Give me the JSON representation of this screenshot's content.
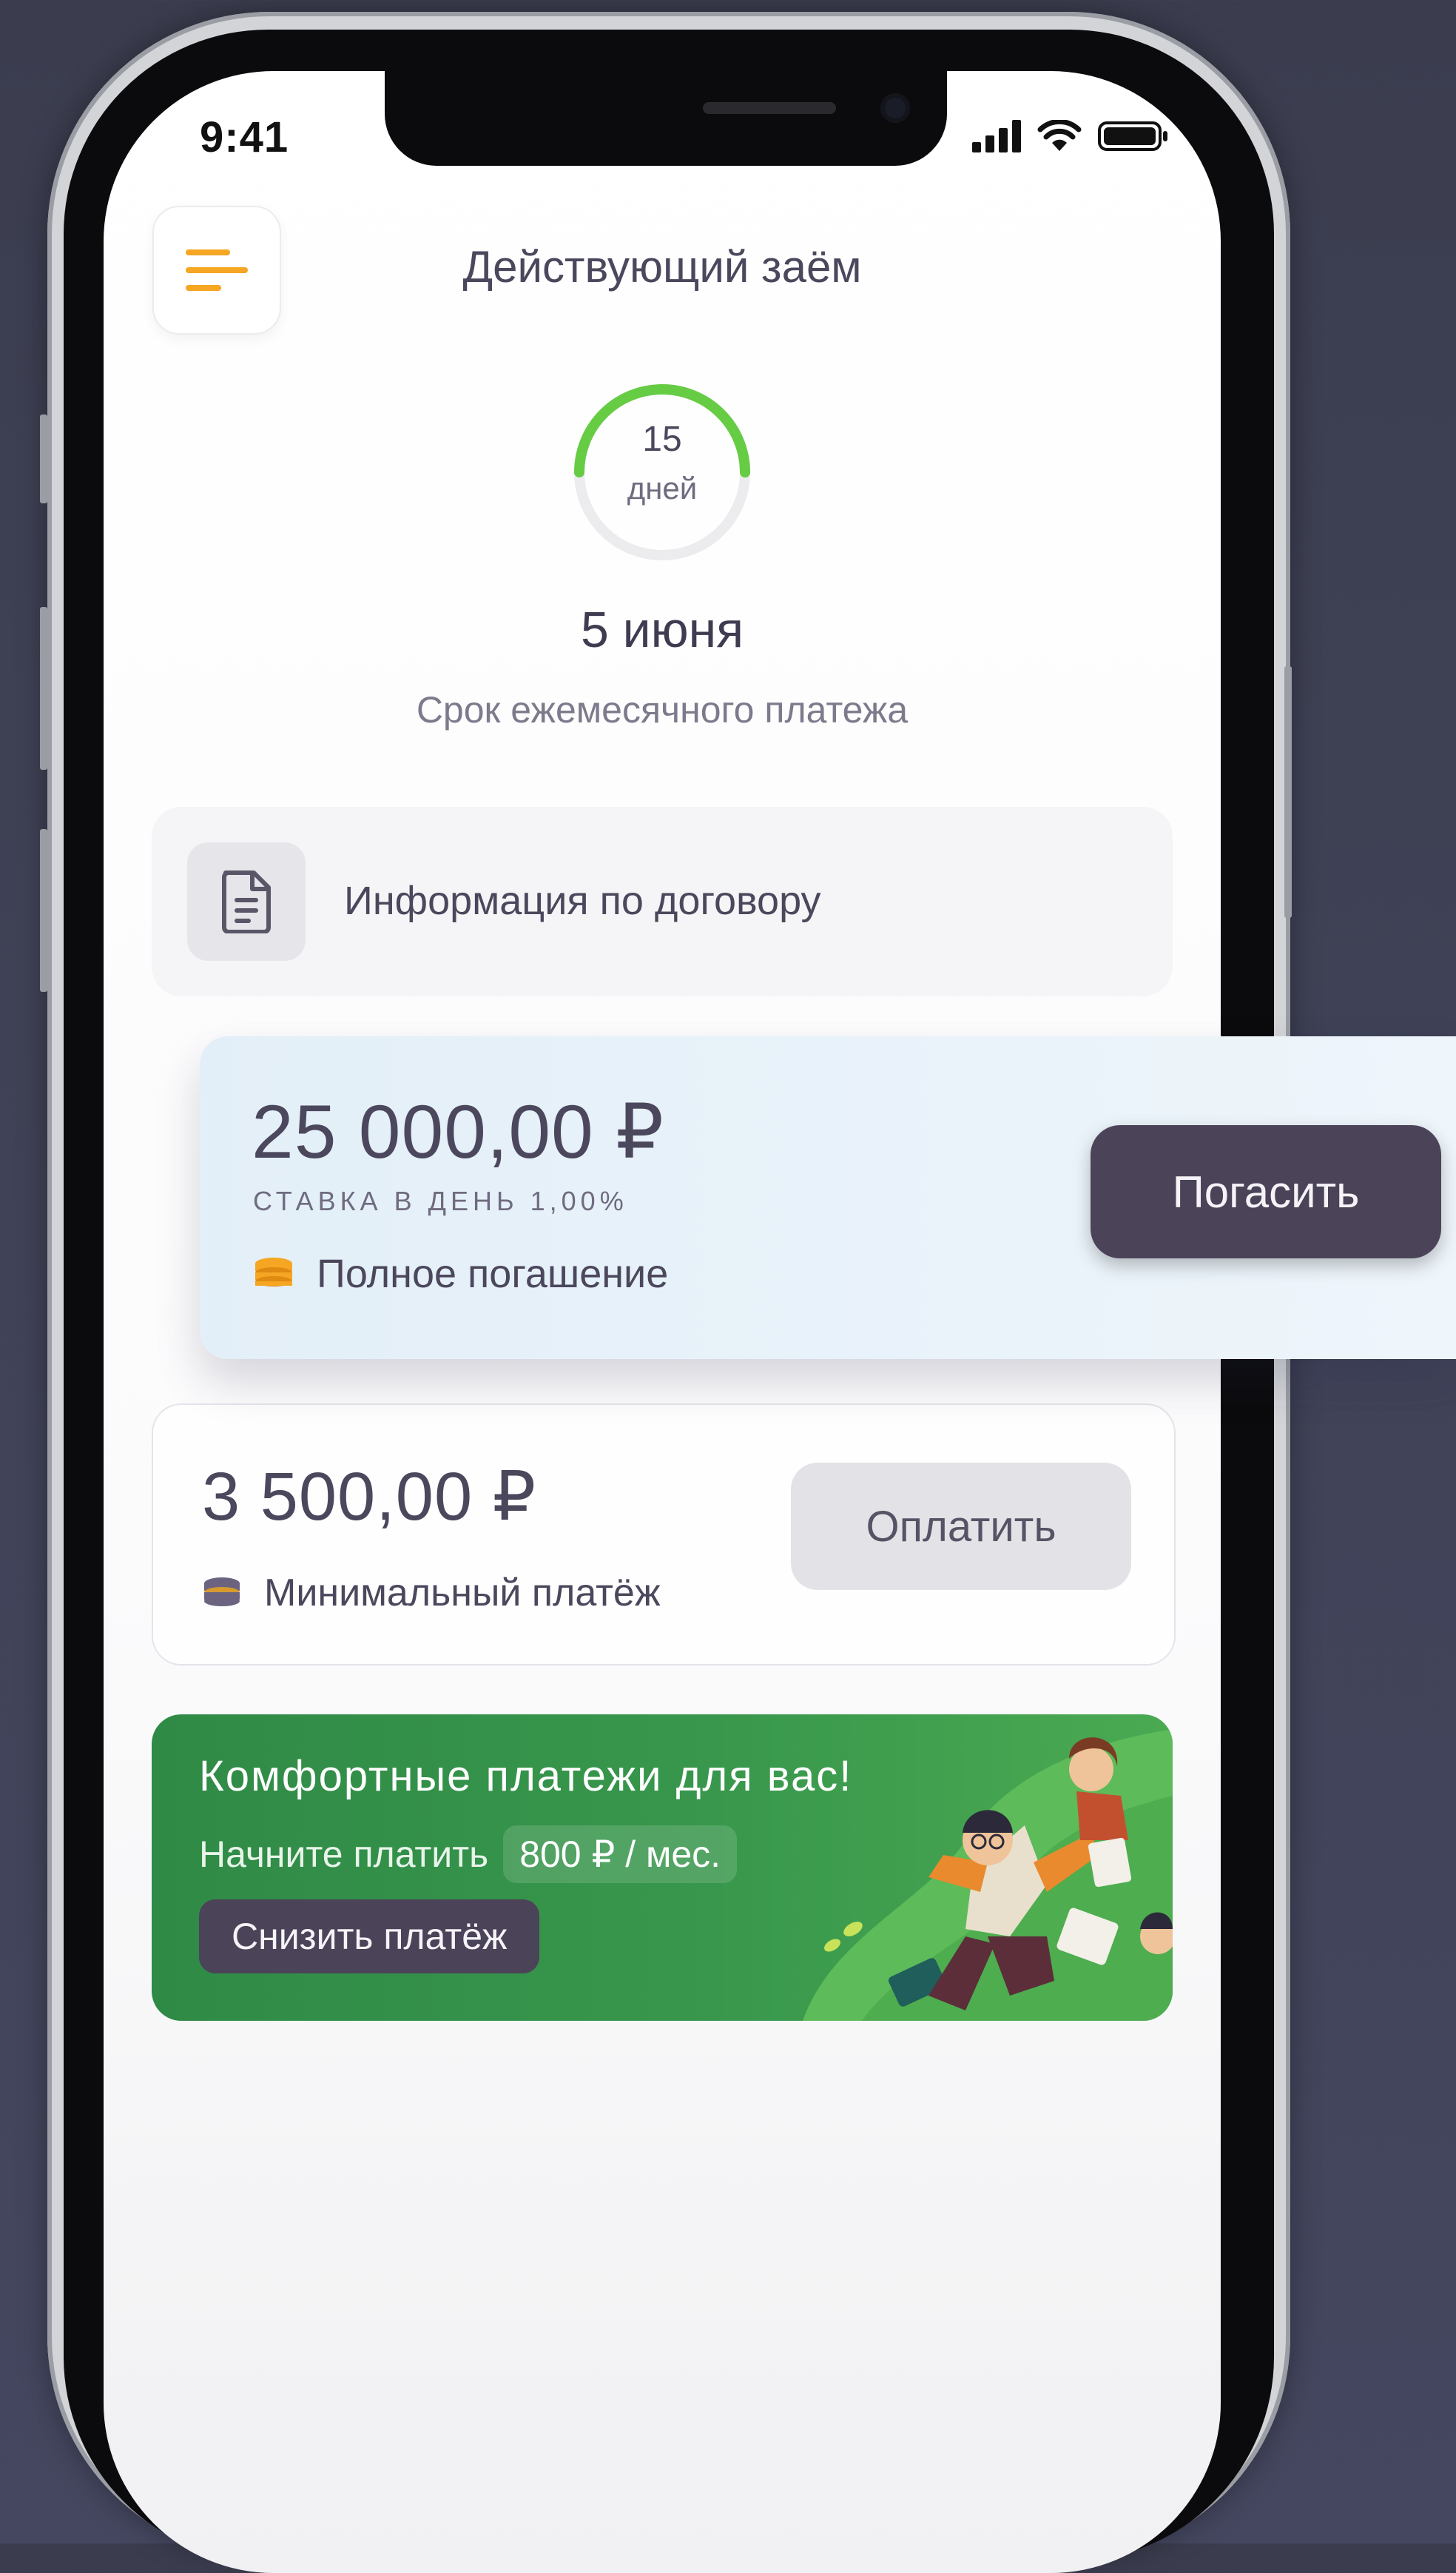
{
  "status_bar": {
    "time": "9:41"
  },
  "header": {
    "title": "Действующий заём"
  },
  "countdown": {
    "number": "15",
    "unit": "дней",
    "progress_fraction": 0.5
  },
  "due": {
    "date": "5 июня",
    "caption": "Срок ежемесячного платежа"
  },
  "contract": {
    "label": "Информация по договору"
  },
  "full_repayment": {
    "amount": "25 000,00 ₽",
    "rate": "СТАВКА В ДЕНЬ  1,00%",
    "label": "Полное погашение",
    "button": "Погасить"
  },
  "minimum_payment": {
    "amount": "3 500,00 ₽",
    "label": "Минимальный платёж",
    "button": "Оплатить"
  },
  "promo": {
    "title": "Комфортные платежи для вас!",
    "subtitle": "Начните платить",
    "price": "800 ₽ / мес.",
    "button": "Снизить платёж"
  },
  "colors": {
    "accent_orange": "#f5a623",
    "progress_green": "#66cc44",
    "dark_button": "#4b4358",
    "promo_green": "#38974c"
  }
}
